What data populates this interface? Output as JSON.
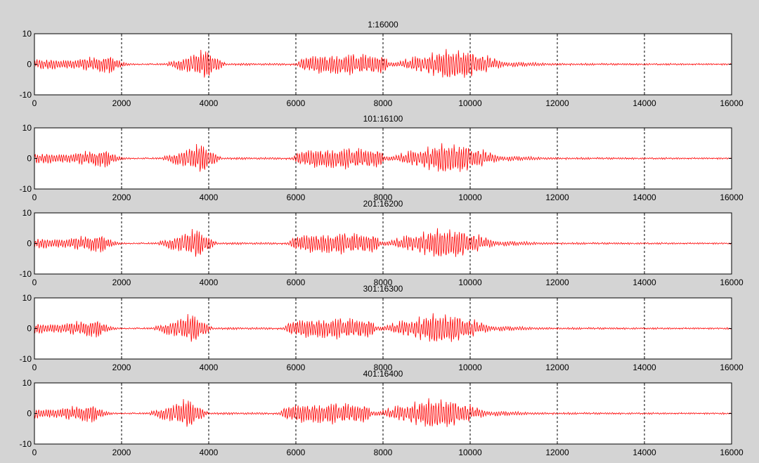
{
  "figure": {
    "background": "#d4d4d4",
    "axes_background": "#ffffff",
    "signal_color": "#ff0000",
    "grid_color": "#000000"
  },
  "chart_data": [
    {
      "type": "line",
      "title": "1:16000",
      "xlim": [
        0,
        16000
      ],
      "ylim": [
        -10,
        10
      ],
      "xticks": [
        0,
        2000,
        4000,
        6000,
        8000,
        10000,
        12000,
        14000,
        16000
      ],
      "yticks": [
        -10,
        0,
        10
      ],
      "grid": "x-dashed",
      "offset": 0,
      "series": [
        {
          "x": [
            0,
            1000,
            1300,
            1700,
            2000,
            2200,
            3000,
            3100,
            3600,
            3900,
            4400,
            6000,
            6200,
            7000,
            8000,
            8200,
            9000,
            9500,
            10000,
            10800,
            12000,
            16000
          ],
          "y_envelope": [
            1.5,
            1.5,
            2.5,
            3.0,
            1.0,
            0.2,
            0.2,
            1.0,
            3.0,
            5.0,
            0.3,
            0.3,
            2.5,
            3.5,
            3.0,
            0.5,
            3.5,
            5.0,
            4.5,
            0.8,
            0.3,
            0.2
          ]
        }
      ]
    },
    {
      "type": "line",
      "title": "101:16100",
      "xlim": [
        0,
        16000
      ],
      "ylim": [
        -10,
        10
      ],
      "xticks": [
        0,
        2000,
        4000,
        6000,
        8000,
        10000,
        12000,
        14000,
        16000
      ],
      "yticks": [
        -10,
        0,
        10
      ],
      "grid": "x-dashed",
      "offset": 100,
      "series": [
        {
          "x": [
            0,
            1000,
            1300,
            1700,
            2000,
            2200,
            3000,
            3100,
            3600,
            3900,
            4400,
            6000,
            6200,
            7000,
            8000,
            8200,
            9000,
            9500,
            10000,
            10800,
            12000,
            16000
          ],
          "y_envelope": [
            1.5,
            1.5,
            2.5,
            3.0,
            1.0,
            0.2,
            0.2,
            1.0,
            3.0,
            5.0,
            0.3,
            0.3,
            2.5,
            3.5,
            3.0,
            0.5,
            3.5,
            5.0,
            4.5,
            0.8,
            0.3,
            0.2
          ]
        }
      ]
    },
    {
      "type": "line",
      "title": "201:16200",
      "xlim": [
        0,
        16000
      ],
      "ylim": [
        -10,
        10
      ],
      "xticks": [
        0,
        2000,
        4000,
        6000,
        8000,
        10000,
        12000,
        14000,
        16000
      ],
      "yticks": [
        -10,
        0,
        10
      ],
      "grid": "x-dashed",
      "offset": 200,
      "series": [
        {
          "x": [
            0,
            1000,
            1300,
            1700,
            2000,
            2200,
            3000,
            3100,
            3600,
            3900,
            4400,
            6000,
            6200,
            7000,
            8000,
            8200,
            9000,
            9500,
            10000,
            10800,
            12000,
            16000
          ],
          "y_envelope": [
            1.5,
            1.5,
            2.5,
            3.0,
            1.0,
            0.2,
            0.2,
            1.0,
            3.0,
            5.0,
            0.3,
            0.3,
            2.5,
            3.5,
            3.0,
            0.5,
            3.5,
            5.0,
            4.5,
            0.8,
            0.3,
            0.2
          ]
        }
      ]
    },
    {
      "type": "line",
      "title": "301:16300",
      "xlim": [
        0,
        16000
      ],
      "ylim": [
        -10,
        10
      ],
      "xticks": [
        0,
        2000,
        4000,
        6000,
        8000,
        10000,
        12000,
        14000,
        16000
      ],
      "yticks": [
        -10,
        0,
        10
      ],
      "grid": "x-dashed",
      "offset": 300,
      "series": [
        {
          "x": [
            0,
            1000,
            1300,
            1700,
            2000,
            2200,
            3000,
            3100,
            3600,
            3900,
            4400,
            6000,
            6200,
            7000,
            8000,
            8200,
            9000,
            9500,
            10000,
            10800,
            12000,
            16000
          ],
          "y_envelope": [
            1.5,
            1.5,
            2.5,
            3.0,
            1.0,
            0.2,
            0.2,
            1.0,
            3.0,
            5.0,
            0.3,
            0.3,
            2.5,
            3.5,
            3.0,
            0.5,
            3.5,
            5.0,
            4.5,
            0.8,
            0.3,
            0.2
          ]
        }
      ]
    },
    {
      "type": "line",
      "title": "401:16400",
      "xlim": [
        0,
        16000
      ],
      "ylim": [
        -10,
        10
      ],
      "xticks": [
        0,
        2000,
        4000,
        6000,
        8000,
        10000,
        12000,
        14000,
        16000
      ],
      "yticks": [
        -10,
        0,
        10
      ],
      "grid": "x-dashed",
      "offset": 400,
      "series": [
        {
          "x": [
            0,
            1000,
            1300,
            1700,
            2000,
            2200,
            3000,
            3100,
            3600,
            3900,
            4400,
            6000,
            6200,
            7000,
            8000,
            8200,
            9000,
            9500,
            10000,
            10800,
            12000,
            16000
          ],
          "y_envelope": [
            1.5,
            1.5,
            2.5,
            3.0,
            1.0,
            0.2,
            0.2,
            1.0,
            3.0,
            5.0,
            0.3,
            0.3,
            2.5,
            3.5,
            3.0,
            0.5,
            3.5,
            5.0,
            4.5,
            0.8,
            0.3,
            0.2
          ]
        }
      ]
    }
  ]
}
